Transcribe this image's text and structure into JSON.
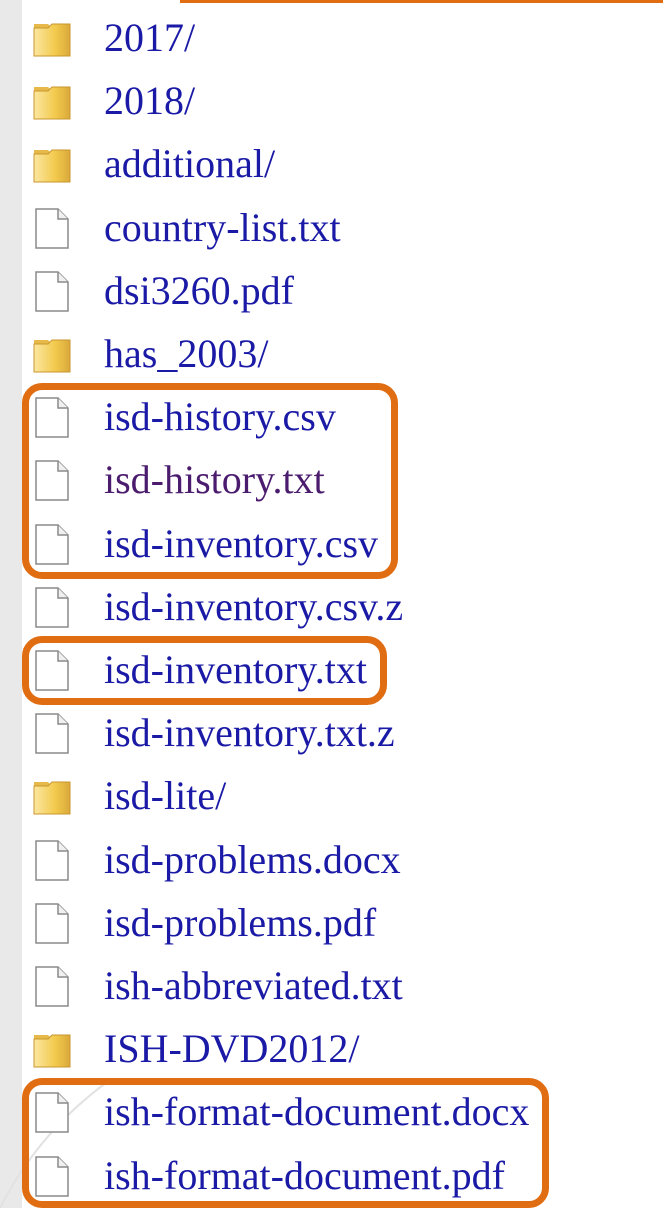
{
  "colors": {
    "link": "#1a1aa6",
    "visited_link": "#4b1c6e",
    "highlight": "#e06d12",
    "folder": "#f2c94c",
    "top_accent": "#e06d12"
  },
  "entries": [
    {
      "name": "2017/",
      "type": "folder",
      "icon": "folder-icon"
    },
    {
      "name": "2018/",
      "type": "folder",
      "icon": "folder-icon"
    },
    {
      "name": "additional/",
      "type": "folder",
      "icon": "folder-icon"
    },
    {
      "name": "country-list.txt",
      "type": "file",
      "icon": "file-icon"
    },
    {
      "name": "dsi3260.pdf",
      "type": "file",
      "icon": "file-icon"
    },
    {
      "name": "has_2003/",
      "type": "folder",
      "icon": "folder-icon"
    },
    {
      "name": "isd-history.csv",
      "type": "file",
      "icon": "file-icon",
      "highlighted": true
    },
    {
      "name": "isd-history.txt",
      "type": "file",
      "icon": "file-icon",
      "highlighted": true,
      "visited": true
    },
    {
      "name": "isd-inventory.csv",
      "type": "file",
      "icon": "file-icon",
      "highlighted": true
    },
    {
      "name": "isd-inventory.csv.z",
      "type": "file",
      "icon": "file-icon"
    },
    {
      "name": "isd-inventory.txt",
      "type": "file",
      "icon": "file-icon",
      "highlighted": true
    },
    {
      "name": "isd-inventory.txt.z",
      "type": "file",
      "icon": "file-icon"
    },
    {
      "name": "isd-lite/",
      "type": "folder",
      "icon": "folder-icon"
    },
    {
      "name": "isd-problems.docx",
      "type": "file",
      "icon": "file-icon"
    },
    {
      "name": "isd-problems.pdf",
      "type": "file",
      "icon": "file-icon"
    },
    {
      "name": "ish-abbreviated.txt",
      "type": "file",
      "icon": "file-icon"
    },
    {
      "name": "ISH-DVD2012/",
      "type": "folder",
      "icon": "folder-icon"
    },
    {
      "name": "ish-format-document.docx",
      "type": "file",
      "icon": "file-icon",
      "highlighted": true
    },
    {
      "name": "ish-format-document.pdf",
      "type": "file",
      "icon": "file-icon",
      "highlighted": true
    }
  ]
}
